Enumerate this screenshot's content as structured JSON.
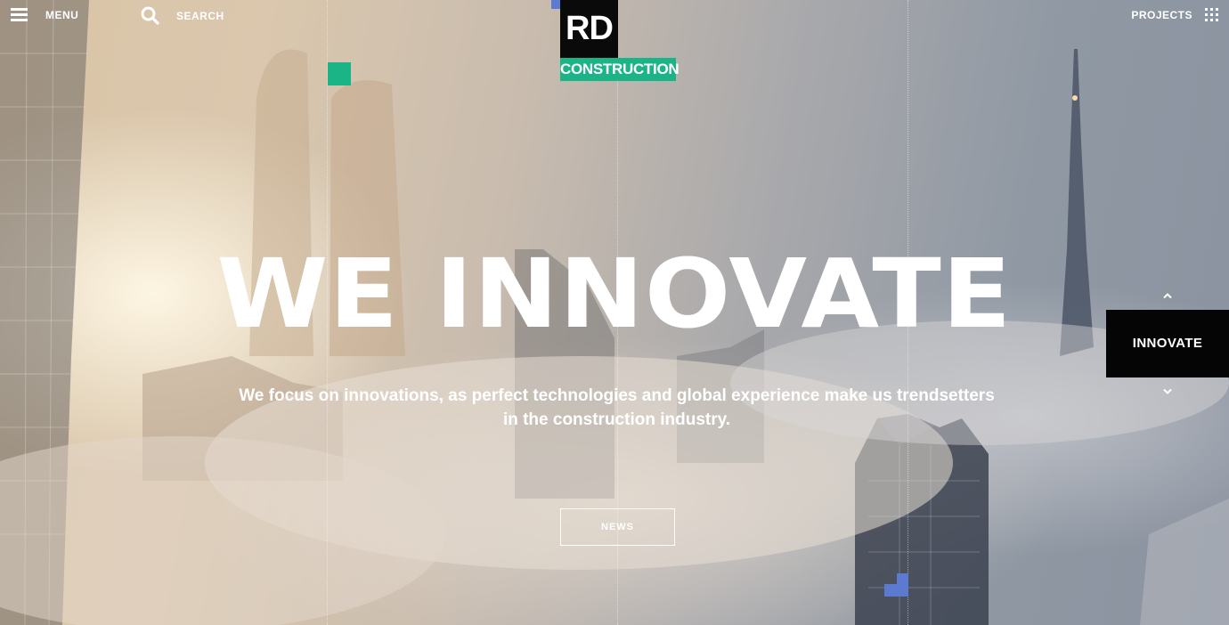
{
  "header": {
    "menu_label": "MENU",
    "search_label": "SEARCH",
    "projects_label": "PROJECTS"
  },
  "logo": {
    "mark": "RD",
    "subtitle": "CONSTRUCTION"
  },
  "hero": {
    "title": "WE INNOVATE",
    "line1": "We focus on innovations, as perfect technologies and global experience make us trendsetters",
    "line2": "in the construction industry.",
    "button_label": "NEWS"
  },
  "slider_nav": {
    "current_label": "INNOVATE",
    "up_icon": "chevron-up-icon",
    "down_icon": "chevron-down-icon"
  },
  "colors": {
    "brand_green": "#1bb487",
    "accent_blue": "#5b7ad0",
    "logo_black": "#0a0a0a"
  },
  "icons": [
    "menu-icon",
    "search-icon",
    "grid-icon"
  ]
}
